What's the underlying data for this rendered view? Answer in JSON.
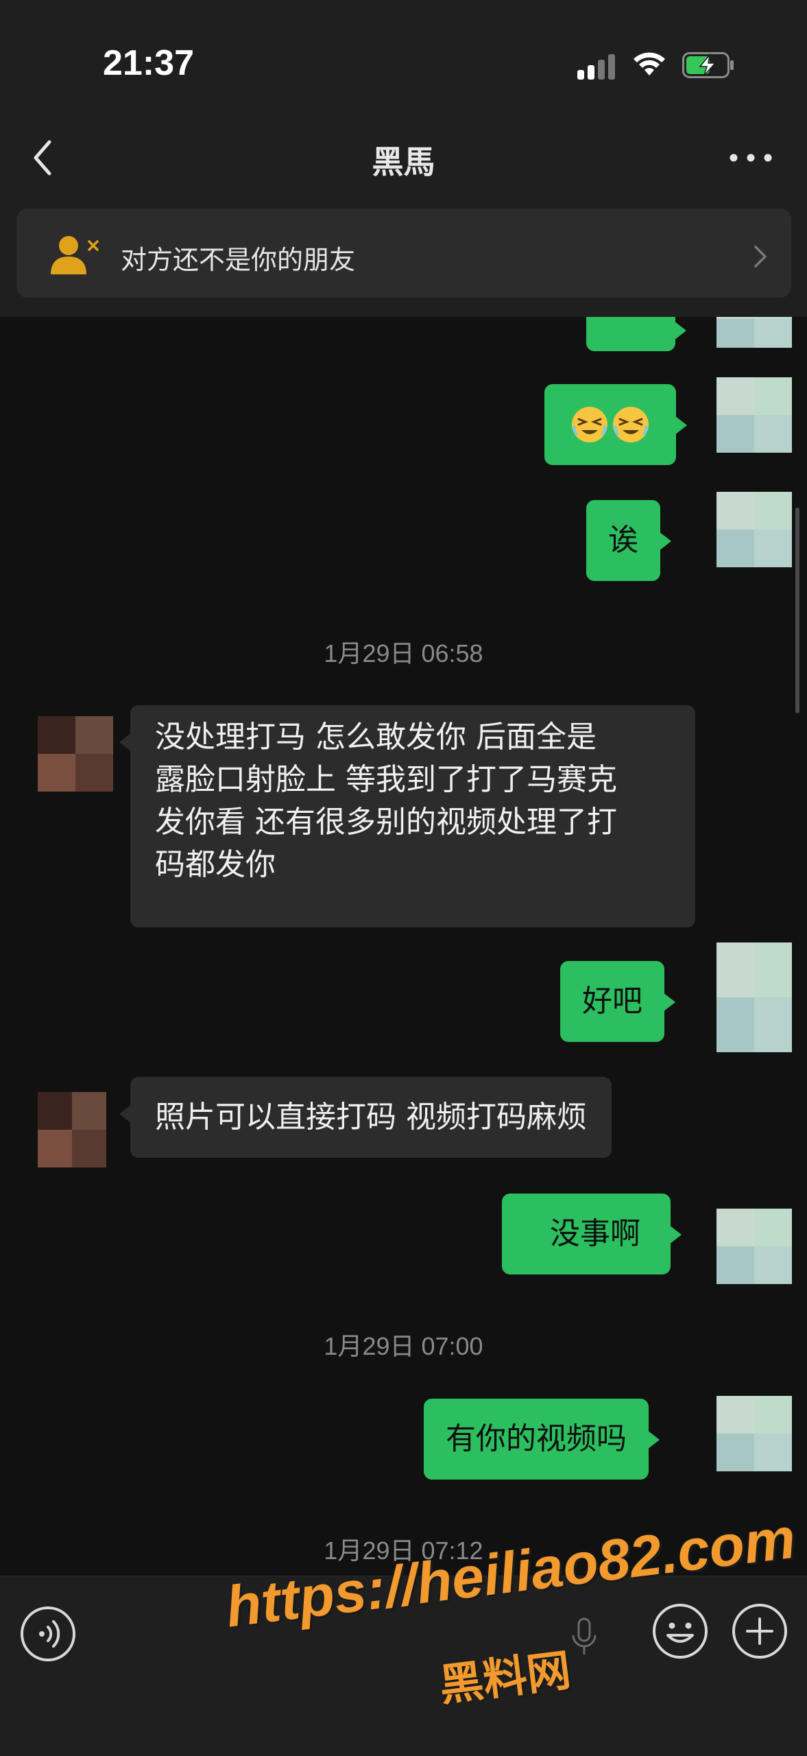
{
  "status_bar": {
    "time": "21:37"
  },
  "header": {
    "title": "黑馬"
  },
  "notice": {
    "text": "对方还不是你的朋友"
  },
  "messages": [
    {
      "type": "outgoing",
      "kind": "partial"
    },
    {
      "type": "outgoing",
      "kind": "emoji",
      "emoji": [
        "weary-laugh",
        "weary-laugh"
      ]
    },
    {
      "type": "outgoing",
      "text": "诶"
    },
    {
      "type": "timestamp",
      "text": "1月29日 06:58"
    },
    {
      "type": "incoming",
      "lines": [
        "没处理打马 怎么敢发你 后面全是",
        "露脸口射脸上 等我到了打了马赛克",
        "发你看 还有很多别的视频处理了打",
        "码都发你"
      ]
    },
    {
      "type": "outgoing",
      "text": "好吧"
    },
    {
      "type": "incoming",
      "text": "照片可以直接打码 视频打码麻烦"
    },
    {
      "type": "outgoing",
      "text": "没事啊"
    },
    {
      "type": "timestamp",
      "text": "1月29日 07:00"
    },
    {
      "type": "outgoing",
      "text": "有你的视频吗"
    },
    {
      "type": "timestamp",
      "text": "1月29日 07:12"
    }
  ],
  "input_bar": {
    "icons": [
      "voice-icon",
      "mic-icon",
      "emoji-icon",
      "plus-icon"
    ]
  },
  "watermark": {
    "line1": "https://heiliao82.com",
    "line2": "黑料网"
  },
  "colors": {
    "outgoing_bubble": "#2bbf60",
    "incoming_bubble": "#2c2c2c",
    "background": "#111111",
    "watermark": "#f29a2e"
  }
}
